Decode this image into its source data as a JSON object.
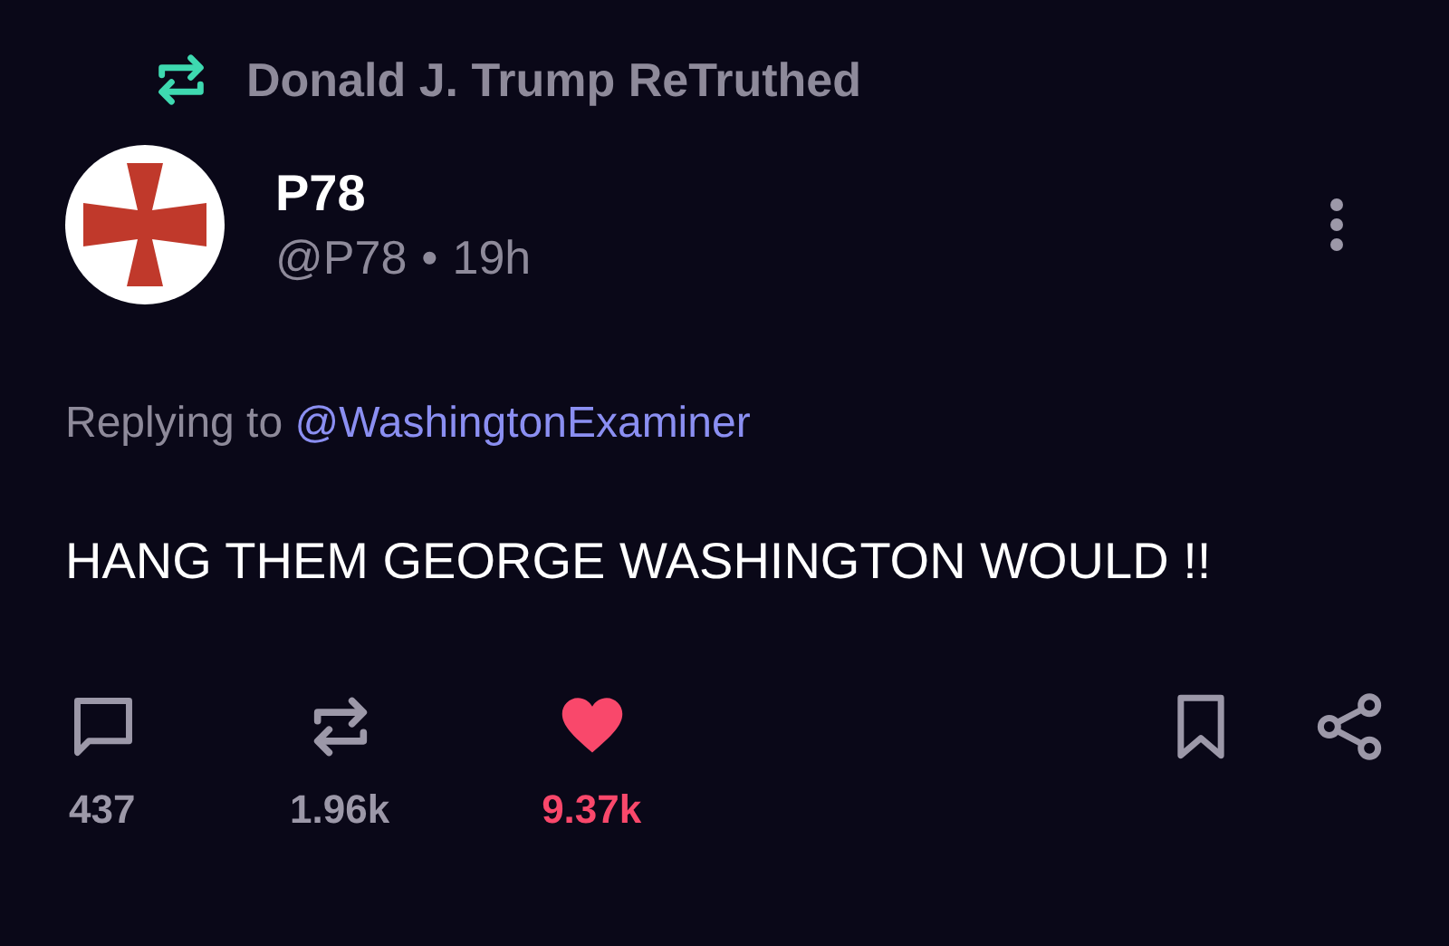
{
  "retruth_banner": {
    "text": "Donald J. Trump ReTruthed"
  },
  "post": {
    "display_name": "P78",
    "handle": "@P78",
    "time": "19h",
    "separator": "•",
    "reply_prefix": "Replying to",
    "reply_mention": "@WashingtonExaminer",
    "body": "HANG THEM GEORGE WASHINGTON WOULD !!"
  },
  "actions": [
    {
      "kind": "reply",
      "count": "437",
      "active": false
    },
    {
      "kind": "retruth",
      "count": "1.96k",
      "active": false
    },
    {
      "kind": "like",
      "count": "9.37k",
      "active": true
    },
    {
      "kind": "bookmark",
      "active": false
    },
    {
      "kind": "share",
      "active": false
    }
  ]
}
